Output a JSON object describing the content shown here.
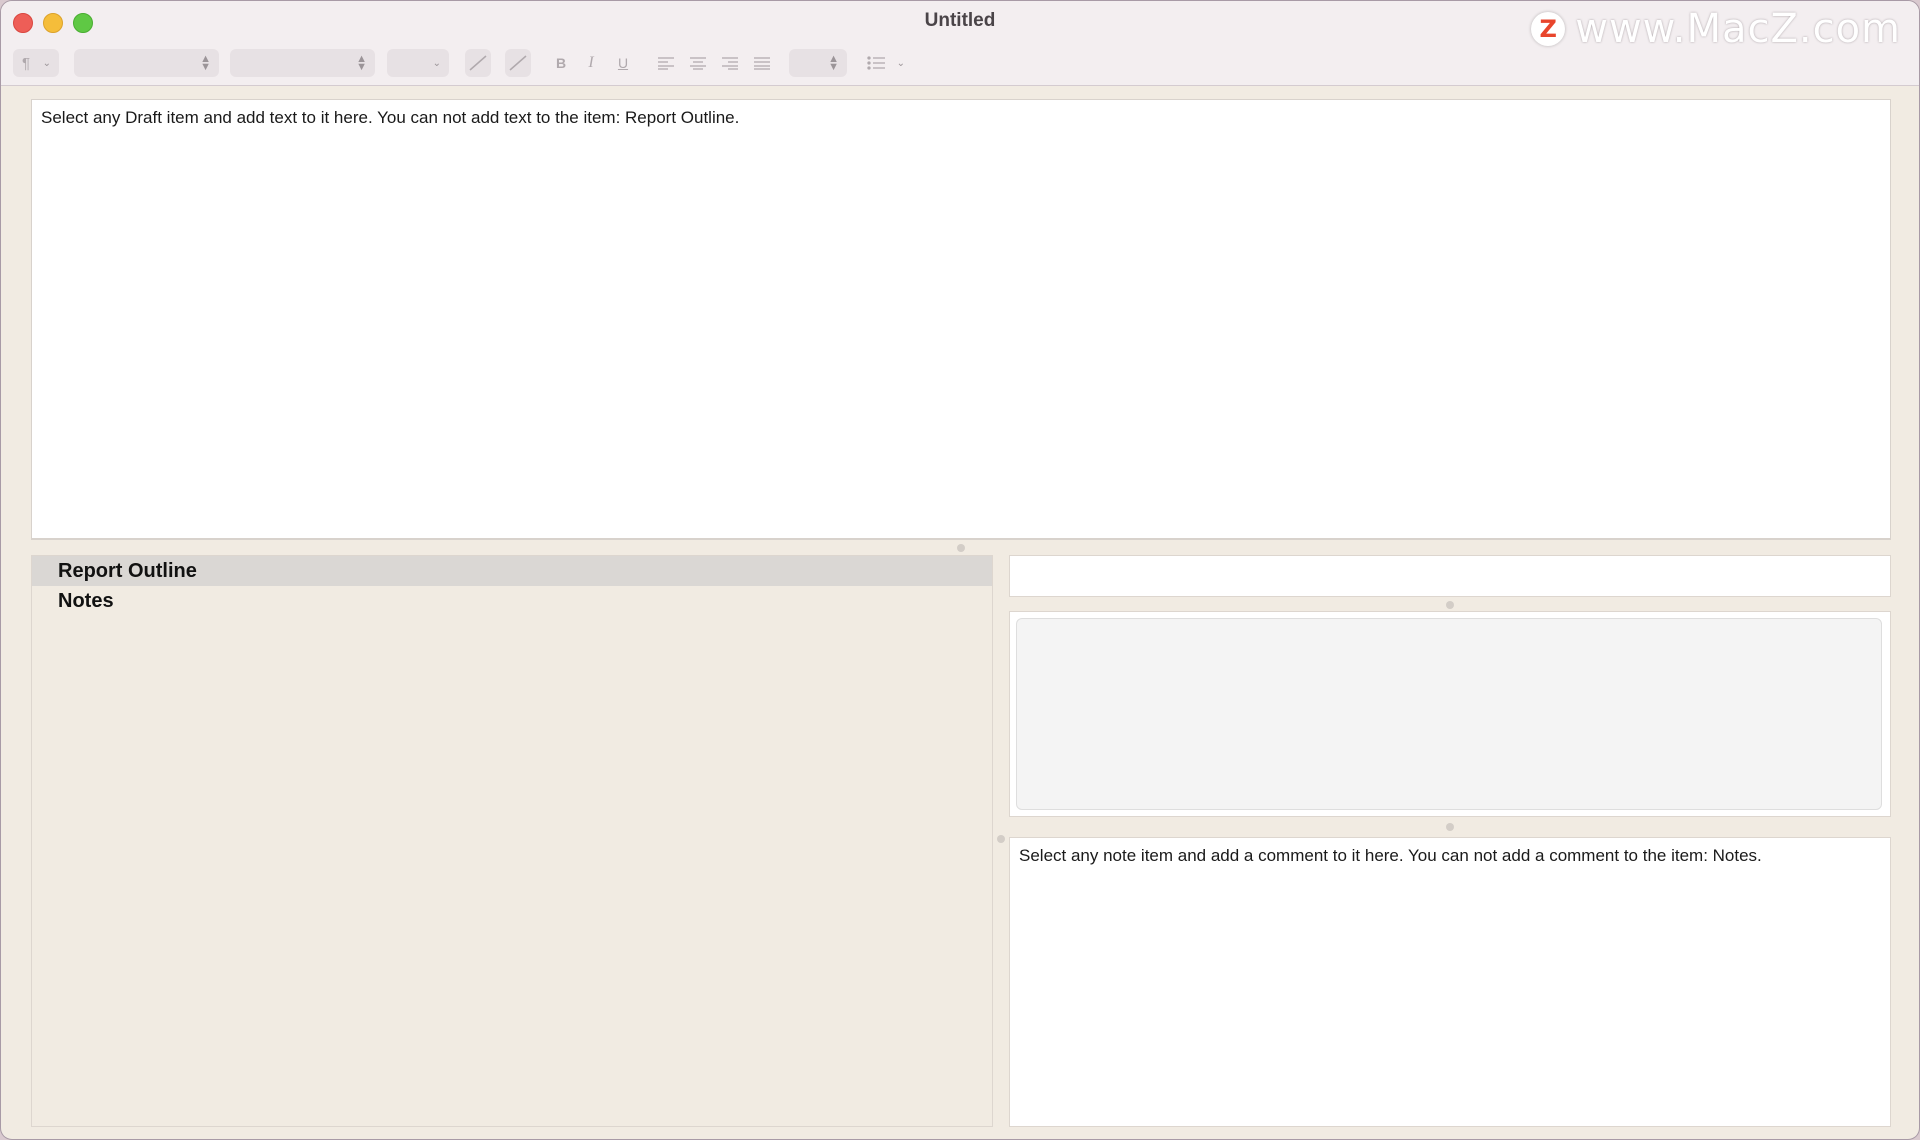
{
  "window": {
    "title": "Untitled",
    "watermark_logo": "Z",
    "watermark_text": "www.MacZ.com"
  },
  "toolbar": {
    "paragraph_style": "¶",
    "bold_label": "B",
    "italic_label": "I",
    "underline_label": "U",
    "icons": [
      "pilcrow-icon",
      "text-color-icon",
      "highlight-color-icon",
      "align-left-icon",
      "align-center-icon",
      "align-right-icon",
      "align-justify-icon",
      "list-icon"
    ]
  },
  "draft": {
    "text": "Select any Draft item and add text to it here.  You can not add text to the item: Report Outline."
  },
  "outline": {
    "items": [
      {
        "label": "Report Outline",
        "selected": true
      },
      {
        "label": "Notes",
        "selected": false
      }
    ]
  },
  "notes": {
    "comment_text": "Select any note item and add a comment to it here.  You can not add a comment to the item: Notes."
  },
  "colors": {
    "background": "#f1ebe2",
    "titlebar": "#f3eef0",
    "selected_row": "#dad7d4",
    "close": "#ee5e57",
    "minimize": "#f5bd3a",
    "maximize": "#5fc844"
  }
}
